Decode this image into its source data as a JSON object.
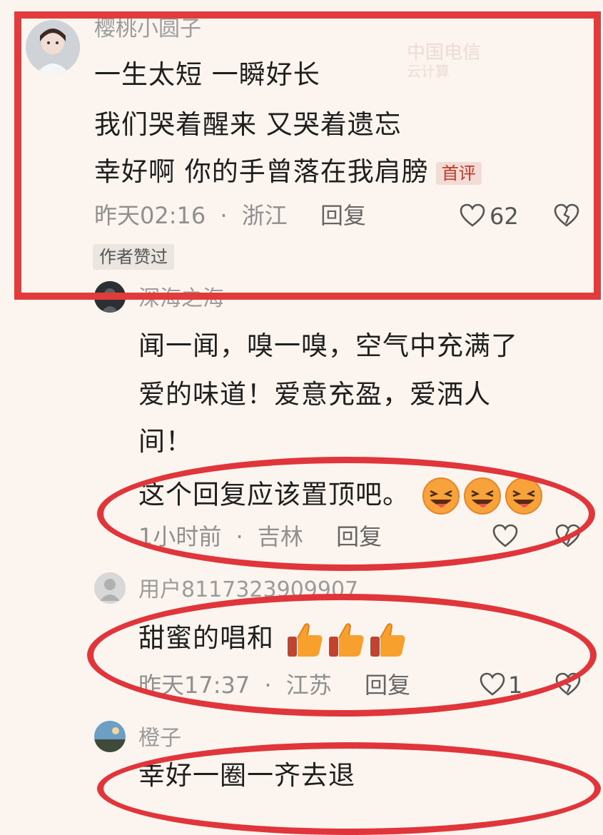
{
  "watermark": {
    "line1": "中国电信",
    "line2": "云计算"
  },
  "comments": [
    {
      "username": "樱桃小圆子",
      "lines": [
        "一生太短 一瞬好长",
        "我们哭着醒来 又哭着遗忘",
        "幸好啊 你的手曾落在我肩膀"
      ],
      "badge": "首评",
      "time": "昨天02:16",
      "location": "浙江",
      "reply": "回复",
      "likes": "62",
      "author_badge": "作者赞过"
    },
    {
      "username": "深海之海",
      "lines": [
        "闻一闻，嗅一嗅，空气中充满了",
        "爱的味道！爱意充盈，爱洒人",
        "间！",
        "这个回复应该置顶吧。"
      ],
      "emoji": [
        "grin-wink-emoji",
        "grin-wink-emoji",
        "grin-wink-emoji"
      ],
      "time": "1小时前",
      "location": "吉林",
      "reply": "回复"
    },
    {
      "username": "用户8117323909907",
      "lines": [
        "甜蜜的唱和"
      ],
      "emoji": [
        "thumbs-up-emoji",
        "thumbs-up-emoji",
        "thumbs-up-emoji"
      ],
      "time": "昨天17:37",
      "location": "江苏",
      "reply": "回复",
      "likes": "1"
    },
    {
      "username": "橙子",
      "lines": [
        "幸好一圈一齐去退"
      ]
    }
  ],
  "separator": "·"
}
